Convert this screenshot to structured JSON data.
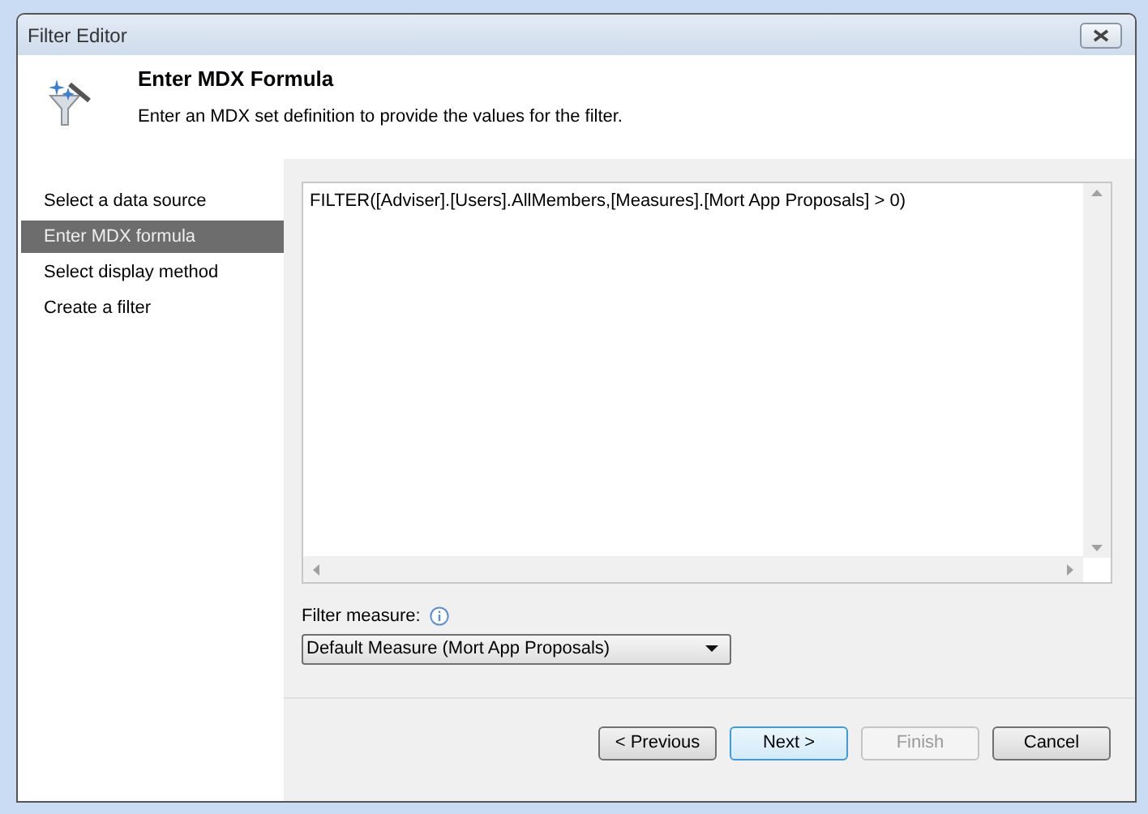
{
  "window": {
    "title": "Filter Editor"
  },
  "header": {
    "title": "Enter MDX Formula",
    "description": "Enter an MDX set definition to provide the values for the filter."
  },
  "steps": [
    {
      "label": "Select a data source",
      "selected": false
    },
    {
      "label": "Enter MDX formula",
      "selected": true
    },
    {
      "label": "Select display method",
      "selected": false
    },
    {
      "label": "Create a filter",
      "selected": false
    }
  ],
  "formula": {
    "value": "FILTER([Adviser].[Users].AllMembers,[Measures].[Mort App Proposals] > 0)"
  },
  "filter_measure": {
    "label": "Filter measure:",
    "value": "Default Measure (Mort App Proposals)"
  },
  "buttons": [
    {
      "label": "< Previous",
      "disabled": false,
      "focused": false
    },
    {
      "label": "Next >",
      "disabled": false,
      "focused": true
    },
    {
      "label": "Finish",
      "disabled": true,
      "focused": false
    },
    {
      "label": "Cancel",
      "disabled": false,
      "focused": false
    }
  ]
}
